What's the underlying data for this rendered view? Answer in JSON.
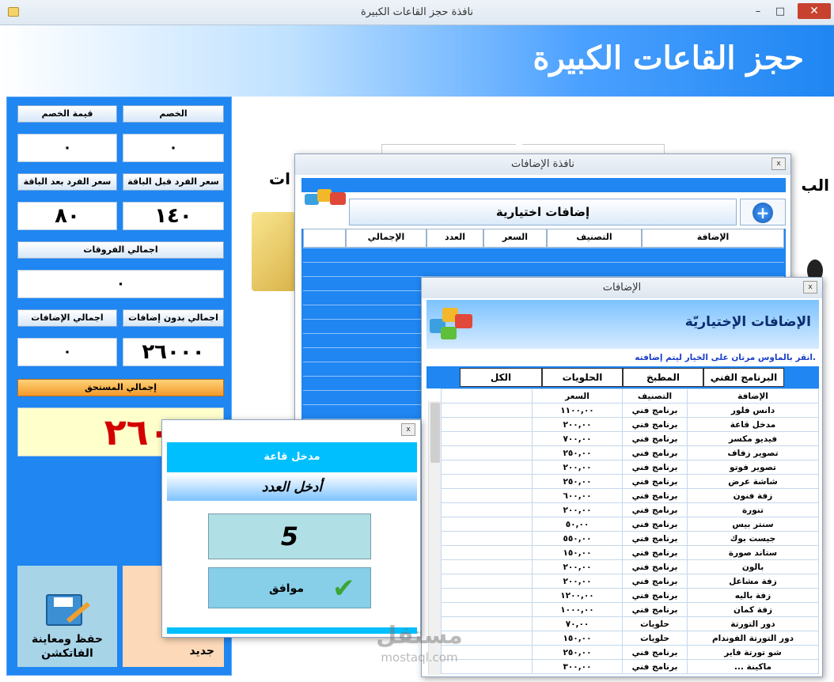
{
  "window": {
    "title": "نافذة حجز القاعات الكبيرة",
    "heading": "حجز القاعات الكبيرة"
  },
  "left": {
    "discount_label": "الخصم",
    "discount_value_label": "قيمة الخصم",
    "discount": "٠",
    "discount_value": "٠",
    "price_before_label": "سعر الفرد قبل الباقة",
    "price_after_label": "سعر الفرد بعد الباقة",
    "price_before": "١٤٠",
    "price_after": "٨٠",
    "diff_label": "اجمالي الفروقات",
    "diff": "٠",
    "total_no_addons_label": "اجمالي بدون إضافات",
    "total_addons_label": "اجمالي الإضافات",
    "total_no_addons": "٢٦٠٠٠",
    "total_addons": "٠",
    "due_label": "إجمالي المستحق",
    "due": "٢٦٠٠٠",
    "save_label": "حفظ ومعاينة الفاتكشن",
    "new_label": "جديد"
  },
  "bg": {
    "partial_text1": "الب",
    "partial_text2": "ات"
  },
  "addons_window": {
    "title": "نافذة الإضافات",
    "header": "إضافات اختيارية",
    "columns": [
      "الإضافة",
      "التصنيف",
      "السعر",
      "العدد",
      "الإجمالي"
    ]
  },
  "extras_window": {
    "title": "الإضافات",
    "header": "الإضافات الإختياريّة",
    "hint": "انقر بالماوس مرتان على الخيار ليتم إضافته.",
    "tabs": [
      "البرنامج الفني",
      "المطبخ",
      "الحلويات",
      "الكل"
    ],
    "columns": [
      "الإضافة",
      "التصنيف",
      "السعر"
    ],
    "rows": [
      [
        "دانس فلور",
        "برنامج فني",
        "١١٠٠,٠٠"
      ],
      [
        "مدخل قاعة",
        "برنامج فني",
        "٢٠٠,٠٠"
      ],
      [
        "فيديو مكسر",
        "برنامج فني",
        "٧٠٠,٠٠"
      ],
      [
        "تصوير زفاف",
        "برنامج فني",
        "٢٥٠,٠٠"
      ],
      [
        "تصوير فوتو",
        "برنامج فني",
        "٢٠٠,٠٠"
      ],
      [
        "شاشة عرض",
        "برنامج فني",
        "٢٥٠,٠٠"
      ],
      [
        "زفة فنون",
        "برنامج فني",
        "٦٠٠,٠٠"
      ],
      [
        "تنورة",
        "برنامج فني",
        "٢٠٠,٠٠"
      ],
      [
        "سنتر بيس",
        "برنامج فني",
        "٥٠,٠٠"
      ],
      [
        "جيست بوك",
        "برنامج فني",
        "٥٥٠,٠٠"
      ],
      [
        "ستاند صورة",
        "برنامج فني",
        "١٥٠,٠٠"
      ],
      [
        "بالون",
        "برنامج فني",
        "٢٠٠,٠٠"
      ],
      [
        "زفة مشاعل",
        "برنامج فني",
        "٢٠٠,٠٠"
      ],
      [
        "زفة باليه",
        "برنامج فني",
        "١٢٠٠,٠٠"
      ],
      [
        "زفة كمان",
        "برنامج فني",
        "١٠٠٠,٠٠"
      ],
      [
        "دور التورتة",
        "حلويات",
        "٧٠,٠٠"
      ],
      [
        "دور التورتة الفوندام",
        "حلويات",
        "١٥٠,٠٠"
      ],
      [
        "شو تورتة فاير",
        "برنامج فني",
        "٢٥٠,٠٠"
      ],
      [
        "ماكينة ...",
        "برنامج فني",
        "٣٠٠,٠٠"
      ]
    ]
  },
  "qty_window": {
    "header": "مدخل قاعة",
    "prompt": "أدخل العدد",
    "value": "5",
    "ok_label": "موافق"
  },
  "watermark": {
    "brand": "مستقل",
    "domain": "mostaql.com"
  },
  "colors": {
    "accent_blue": "#1f86f2",
    "due_red": "#d40000",
    "orange": "#f29a2a"
  }
}
